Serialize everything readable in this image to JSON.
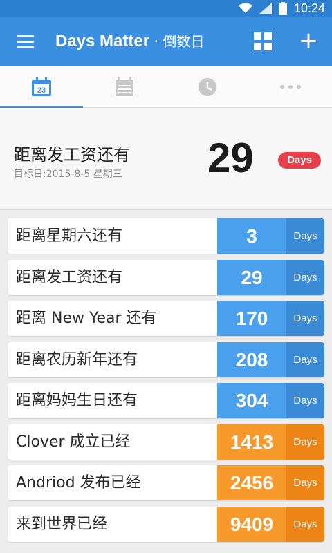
{
  "status_bar": {
    "time": "10:24"
  },
  "app_bar": {
    "title": "Days Matter",
    "subtitle": "· 倒数日"
  },
  "tabs": [
    {
      "icon": "calendar-today-icon",
      "badge": "23",
      "active": true
    },
    {
      "icon": "calendar-icon",
      "active": false
    },
    {
      "icon": "clock-icon",
      "active": false
    },
    {
      "icon": "more-icon",
      "active": false
    }
  ],
  "hero": {
    "title": "距离发工资还有",
    "target_date": "目标日:2015-8-5 星期三",
    "days": "29",
    "unit": "Days"
  },
  "events": [
    {
      "label": "距离星期六还有",
      "days": "3",
      "unit": "Days",
      "kind": "countdown"
    },
    {
      "label": "距离发工资还有",
      "days": "29",
      "unit": "Days",
      "kind": "countdown"
    },
    {
      "label": "距离 New Year 还有",
      "days": "170",
      "unit": "Days",
      "kind": "countdown"
    },
    {
      "label": "距离农历新年还有",
      "days": "208",
      "unit": "Days",
      "kind": "countdown"
    },
    {
      "label": "距离妈妈生日还有",
      "days": "304",
      "unit": "Days",
      "kind": "countdown"
    },
    {
      "label": "Clover 成立已经",
      "days": "1413",
      "unit": "Days",
      "kind": "elapsed"
    },
    {
      "label": "Andriod 发布已经",
      "days": "2456",
      "unit": "Days",
      "kind": "elapsed"
    },
    {
      "label": "来到世界已经",
      "days": "9409",
      "unit": "Days",
      "kind": "elapsed"
    }
  ],
  "colors": {
    "primary": "#3a8fe0",
    "countdown": "#4aa0ec",
    "elapsed": "#f79a2b",
    "badge": "#e8404a"
  }
}
